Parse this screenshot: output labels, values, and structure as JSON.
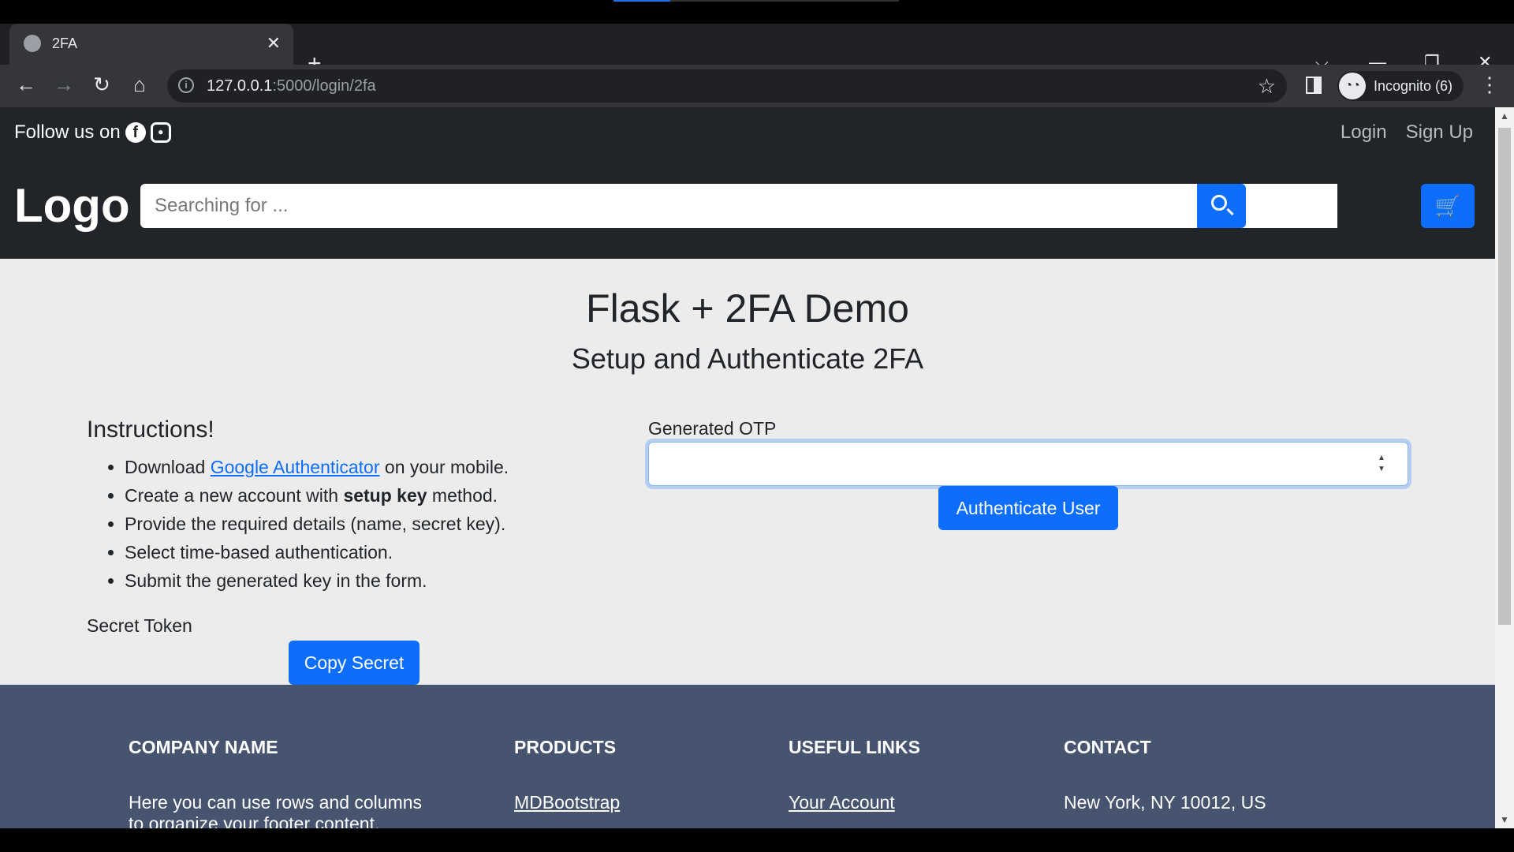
{
  "browser": {
    "tab_title": "2FA",
    "tab_close": "✕",
    "new_tab": "+",
    "url_host": "127.0.0.1",
    "url_path": ":5000/login/2fa",
    "profile_label": "Incognito (6)",
    "window_controls": [
      "⌵",
      "—",
      "❐",
      "✕"
    ]
  },
  "site_header": {
    "follow_text": "Follow us on",
    "social_icons": [
      "facebook-icon",
      "instagram-icon"
    ],
    "login_label": "Login",
    "signup_label": "Sign Up",
    "logo_text": "Logo",
    "search_placeholder": "Searching for ..."
  },
  "main": {
    "title": "Flask + 2FA Demo",
    "subtitle": "Setup and Authenticate 2FA",
    "instructions_title": "Instructions!",
    "instructions": {
      "item1_prefix": "Download ",
      "item1_link": "Google Authenticator",
      "item1_suffix": " on your mobile.",
      "item2_prefix": "Create a new account with ",
      "item2_bold": "setup key",
      "item2_suffix": " method.",
      "item3": "Provide the required details (name, secret key).",
      "item4": "Select time-based authentication.",
      "item5": "Submit the generated key in the form."
    },
    "secret_label": "Secret Token",
    "copy_button": "Copy Secret",
    "otp_label": "Generated OTP",
    "otp_value": "",
    "auth_button": "Authenticate User"
  },
  "footer": {
    "company_heading": "COMPANY NAME",
    "company_text": "Here you can use rows and columns",
    "company_text2": "to organize your footer content.",
    "products_heading": "PRODUCTS",
    "products_link": "MDBootstrap",
    "useful_heading": "USEFUL LINKS",
    "useful_link": "Your Account",
    "contact_heading": "CONTACT",
    "contact_text": "New York, NY 10012, US"
  },
  "colors": {
    "primary": "#0d6efd",
    "header_bg": "#212529",
    "footer_bg": "#475470",
    "page_bg": "#ececec"
  }
}
